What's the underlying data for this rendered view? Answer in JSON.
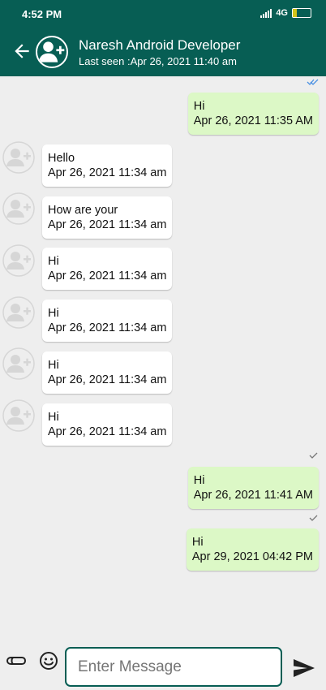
{
  "status_bar": {
    "time": "4:52 PM",
    "network": "4G",
    "battery": "23",
    "battery_level": 0.23,
    "battery_color": "#d4c41a"
  },
  "header": {
    "title": "Naresh Android Developer",
    "subtitle": "Last seen :Apr 26, 2021 11:40 am",
    "background": "#075e54"
  },
  "messages": [
    {
      "direction": "outgoing",
      "text": "Hi",
      "time": "Apr 26, 2021 11:35 AM",
      "status": "read"
    },
    {
      "direction": "incoming",
      "text": "Hello",
      "time": "Apr 26, 2021 11:34 am"
    },
    {
      "direction": "incoming",
      "text": "How are your",
      "time": "Apr 26, 2021 11:34 am"
    },
    {
      "direction": "incoming",
      "text": "Hi",
      "time": "Apr 26, 2021 11:34 am"
    },
    {
      "direction": "incoming",
      "text": "Hi",
      "time": "Apr 26, 2021 11:34 am"
    },
    {
      "direction": "incoming",
      "text": "Hi",
      "time": "Apr 26, 2021 11:34 am"
    },
    {
      "direction": "incoming",
      "text": "Hi",
      "time": "Apr 26, 2021 11:34 am"
    },
    {
      "direction": "outgoing",
      "text": "Hi",
      "time": "Apr 26, 2021 11:41 AM",
      "status": "sent"
    },
    {
      "direction": "outgoing",
      "text": "Hi",
      "time": "Apr 29, 2021 04:42 PM",
      "status": "sent"
    }
  ],
  "composer": {
    "placeholder": "Enter Message",
    "attach_icon": "paperclip-icon",
    "emoji_icon": "emoji-icon",
    "send_icon": "send-icon"
  },
  "colors": {
    "outgoing_bubble": "#dcf8c6",
    "incoming_bubble": "#ffffff",
    "read_tick": "#4a90e2",
    "sent_tick": "#777777"
  }
}
